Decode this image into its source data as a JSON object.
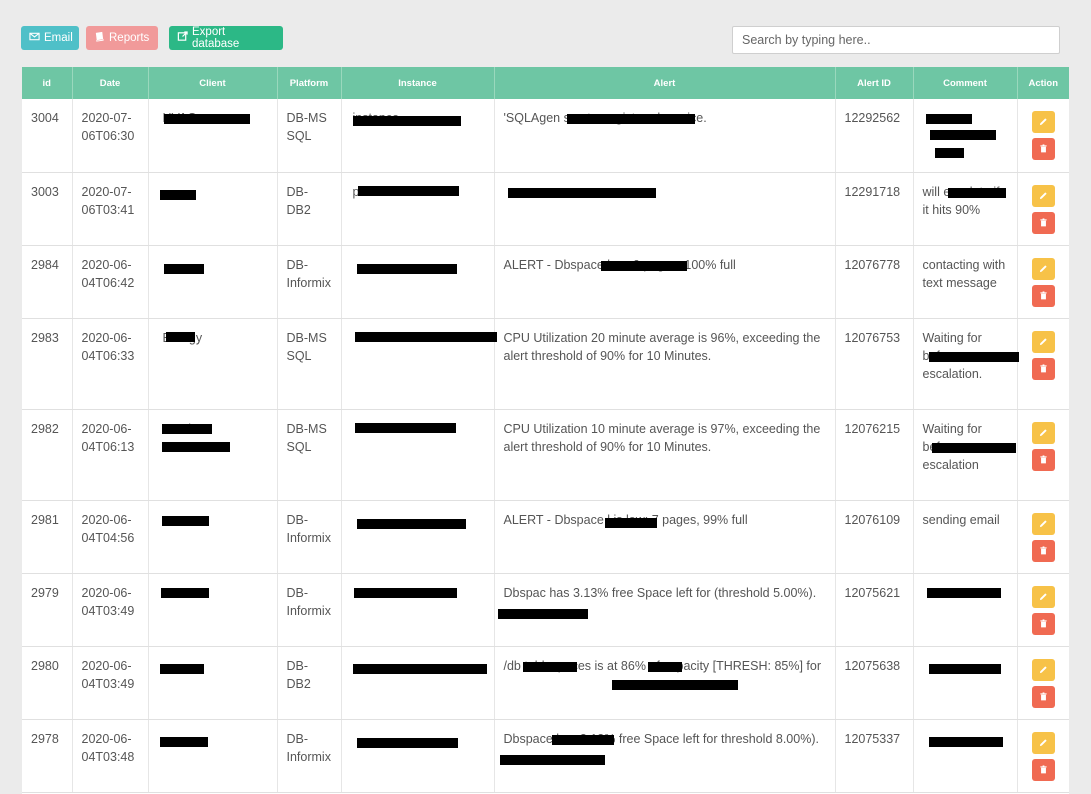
{
  "toolbar": {
    "email_label": "Email",
    "reports_label": "Reports",
    "export_label": "Export database"
  },
  "search": {
    "placeholder": "Search by typing here.."
  },
  "table": {
    "columns": [
      "id",
      "Date",
      "Client",
      "Platform",
      "Instance",
      "Alert",
      "Alert ID",
      "Comment",
      "Action"
    ],
    "rows": [
      {
        "id": "3004",
        "date": "2020-07-06T06:30",
        "client": "HVAC",
        "platform": "DB-MS SQL",
        "instance": "instance",
        "alert": "'SQLAgen                                    s not a registered service.",
        "alert_id": "12292562",
        "comment": ""
      },
      {
        "id": "3003",
        "date": "2020-07-06T03:41",
        "client": "",
        "platform": "DB-DB2",
        "instance": "prod1",
        "alert": "",
        "alert_id": "12291718",
        "comment": "will escalate if it hits 90%"
      },
      {
        "id": "2984",
        "date": "2020-06-04T06:42",
        "client": "",
        "platform": "DB-Informix",
        "instance": "",
        "alert": "ALERT - Dbspace                   low: 0 pages, 100% full",
        "alert_id": "12076778",
        "comment": "contacting        with text message"
      },
      {
        "id": "2983",
        "date": "2020-06-04T06:33",
        "client": "Energy",
        "platform": "DB-MS SQL",
        "instance": "",
        "alert": "CPU Utilization 20 minute average is 96%, exceeding the alert threshold of 90% for 10 Minutes.",
        "alert_id": "12076753",
        "comment": "Waiting for                    before escalation."
      },
      {
        "id": "2982",
        "date": "2020-06-04T06:13",
        "client": "Steel",
        "platform": "DB-MS SQL",
        "instance": "",
        "alert": "CPU Utilization 10 minute average is 97%, exceeding the alert threshold of 90% for 10 Minutes.",
        "alert_id": "12076215",
        "comment": "Waiting for                    before escalation"
      },
      {
        "id": "2981",
        "date": "2020-06-04T04:56",
        "client": "",
        "platform": "DB-Informix",
        "instance": "",
        "alert": "ALERT - Dbspace             l is low: 7 pages, 99% full",
        "alert_id": "12076109",
        "comment": "sending email"
      },
      {
        "id": "2979",
        "date": "2020-06-04T03:49",
        "client": "",
        "platform": "DB-Informix",
        "instance": "",
        "alert": "Dbspac              has 3.13% free Space left for                     (threshold 5.00%).",
        "alert_id": "12075621",
        "comment": ""
      },
      {
        "id": "2980",
        "date": "2020-06-04T03:49",
        "client": "",
        "platform": "DB-DB2",
        "instance": "",
        "alert": "/db             tablespaces          is at 86% of capacity [THRESH: 85%] for",
        "alert_id": "12075638",
        "comment": ""
      },
      {
        "id": "2978",
        "date": "2020-06-04T03:48",
        "client": "",
        "platform": "DB-Informix",
        "instance": "",
        "alert": "Dbspace              has 3.13% free Space left for                          threshold 8.00%).",
        "alert_id": "12075337",
        "comment": ""
      }
    ]
  },
  "colors": {
    "header": "#6ec6a4",
    "email_btn": "#4fc0c8",
    "reports_btn": "#f19a9a",
    "export_btn": "#2cb886",
    "edit_btn": "#f7c248",
    "delete_btn": "#f06a52"
  },
  "icons": {
    "email": "envelope-icon",
    "reports": "book-icon",
    "export": "export-icon",
    "edit": "pencil-icon",
    "delete": "trash-icon"
  }
}
